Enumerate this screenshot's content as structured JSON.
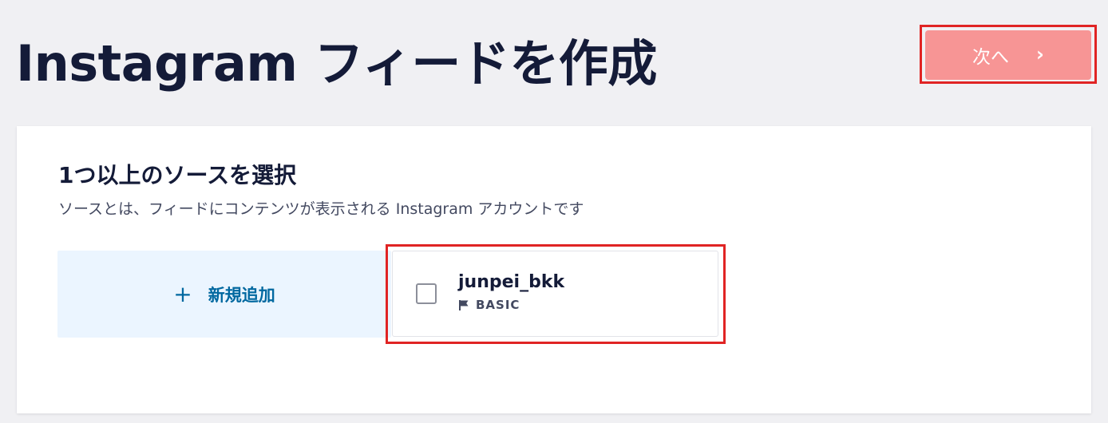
{
  "header": {
    "title": "Instagram フィードを作成",
    "next_label": "次へ",
    "next_icon": "chevron-right-icon"
  },
  "sources": {
    "title": "1つ以上のソースを選択",
    "description": "ソースとは、フィードにコンテンツが表示される Instagram アカウントです",
    "add_new_icon": "plus-icon",
    "add_new_label": "新規追加",
    "items": [
      {
        "name": "junpei_bkk",
        "type_icon": "flag-icon",
        "type": "BASIC",
        "checked": false
      }
    ]
  },
  "colors": {
    "next_button_bg": "#f79595",
    "highlight_border": "#e02424",
    "add_new_bg": "#ebf5ff",
    "add_new_text": "#0068a0",
    "title_text": "#141b38"
  }
}
